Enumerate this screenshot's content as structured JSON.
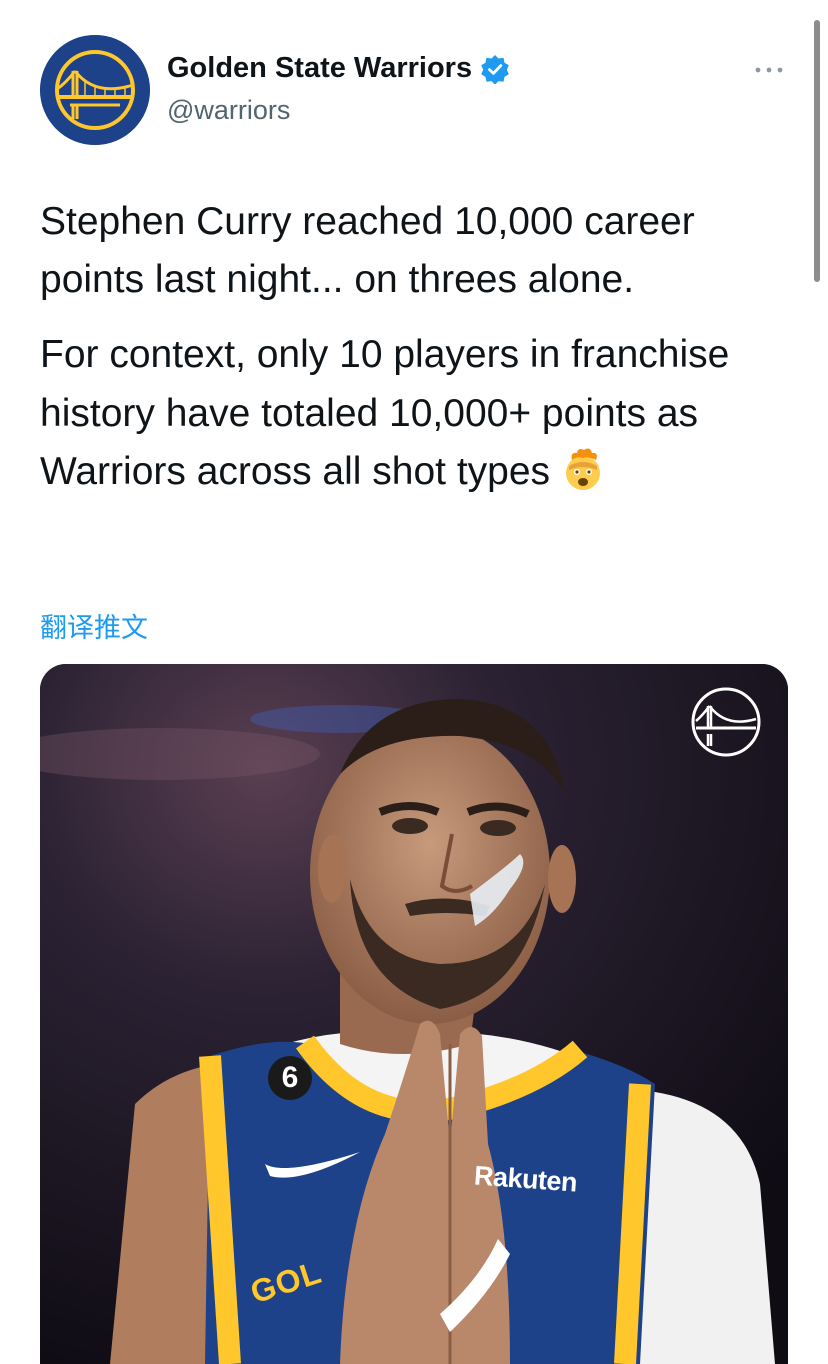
{
  "account": {
    "display_name": "Golden State Warriors",
    "handle": "@warriors",
    "verified": true,
    "avatar_icon": "warriors-bridge-logo-icon",
    "avatar_bg": "#1d428a",
    "avatar_fg": "#ffc72c"
  },
  "tweet": {
    "paragraph1": "Stephen Curry reached 10,000 career points last night... on threes alone.",
    "paragraph2": "For context, only 10 players in franchise history have totaled 10,000+ points as Warriors across all shot types",
    "emoji": "exploding-head-emoji",
    "translate_label": "翻译推文"
  },
  "media": {
    "jersey_number": "6",
    "sponsor": "Rakuten",
    "team_word": "GOL",
    "watermark_icon": "warriors-bridge-logo-icon"
  },
  "colors": {
    "link": "#1d9bf0",
    "secondary_text": "#536471",
    "verified": "#1d9bf0",
    "jersey_blue": "#1d428a",
    "jersey_gold": "#ffc72c"
  },
  "icons": {
    "more": "more-horizontal-icon",
    "verified": "verified-badge-icon"
  }
}
